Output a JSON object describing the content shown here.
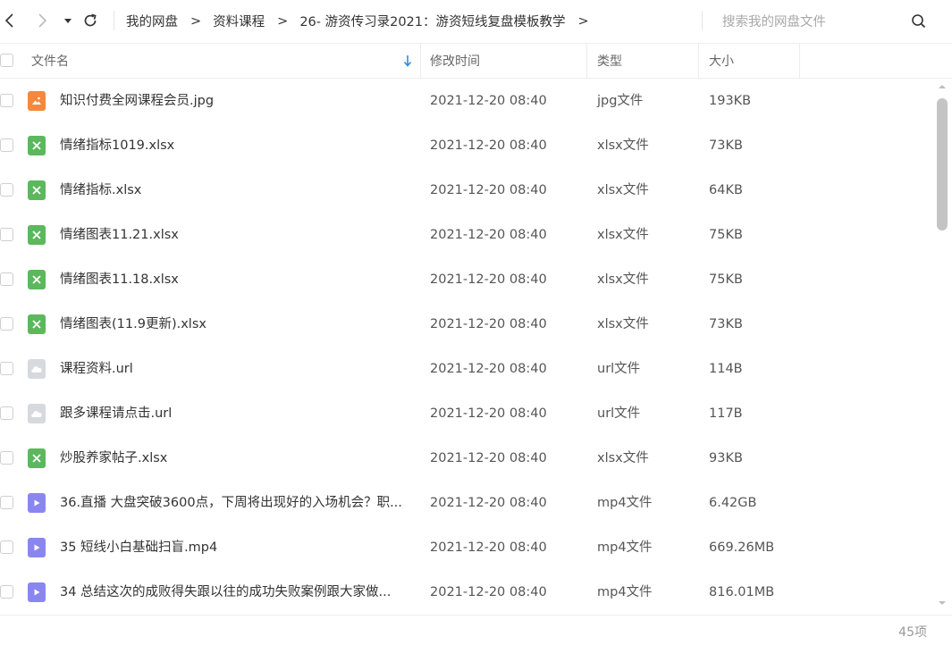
{
  "toolbar": {
    "back_icon": "chevron-left-icon",
    "forward_icon": "chevron-right-icon",
    "dropdown_icon": "caret-down-icon",
    "refresh_icon": "refresh-icon"
  },
  "breadcrumb": {
    "items": [
      "我的网盘",
      "资料课程",
      "26- 游资传习录2021：游资短线复盘模板教学"
    ],
    "separator": ">"
  },
  "search": {
    "placeholder": "搜索我的网盘文件",
    "icon": "search-icon"
  },
  "header": {
    "name": "文件名",
    "modified": "修改时间",
    "type": "类型",
    "size": "大小",
    "sort_icon": "sort-down-arrow-icon",
    "sort_color": "#2d8cf0"
  },
  "files": [
    {
      "name": "知识付费全网课程会员.jpg",
      "time": "2021-12-20 08:40",
      "type": "jpg文件",
      "size": "193KB",
      "kind": "image"
    },
    {
      "name": "情绪指标1019.xlsx",
      "time": "2021-12-20 08:40",
      "type": "xlsx文件",
      "size": "73KB",
      "kind": "excel"
    },
    {
      "name": "情绪指标.xlsx",
      "time": "2021-12-20 08:40",
      "type": "xlsx文件",
      "size": "64KB",
      "kind": "excel"
    },
    {
      "name": "情绪图表11.21.xlsx",
      "time": "2021-12-20 08:40",
      "type": "xlsx文件",
      "size": "75KB",
      "kind": "excel"
    },
    {
      "name": "情绪图表11.18.xlsx",
      "time": "2021-12-20 08:40",
      "type": "xlsx文件",
      "size": "75KB",
      "kind": "excel"
    },
    {
      "name": "情绪图表(11.9更新).xlsx",
      "time": "2021-12-20 08:40",
      "type": "xlsx文件",
      "size": "73KB",
      "kind": "excel"
    },
    {
      "name": "课程资料.url",
      "time": "2021-12-20 08:40",
      "type": "url文件",
      "size": "114B",
      "kind": "url"
    },
    {
      "name": "跟多课程请点击.url",
      "time": "2021-12-20 08:40",
      "type": "url文件",
      "size": "117B",
      "kind": "url"
    },
    {
      "name": "炒股养家帖子.xlsx",
      "time": "2021-12-20 08:40",
      "type": "xlsx文件",
      "size": "93KB",
      "kind": "excel"
    },
    {
      "name": "36.直播 大盘突破3600点，下周将出现好的入场机会？职...",
      "time": "2021-12-20 08:40",
      "type": "mp4文件",
      "size": "6.42GB",
      "kind": "video"
    },
    {
      "name": "35 短线小白基础扫盲.mp4",
      "time": "2021-12-20 08:40",
      "type": "mp4文件",
      "size": "669.26MB",
      "kind": "video"
    },
    {
      "name": "34 总结这次的成败得失跟以往的成功失败案例跟大家做...",
      "time": "2021-12-20 08:40",
      "type": "mp4文件",
      "size": "816.01MB",
      "kind": "video"
    }
  ],
  "icon_colors": {
    "image": "#f5883b",
    "excel": "#5cb85c",
    "url": "#d6d9de",
    "video": "#8a86f0"
  },
  "footer": {
    "count": "45项"
  }
}
